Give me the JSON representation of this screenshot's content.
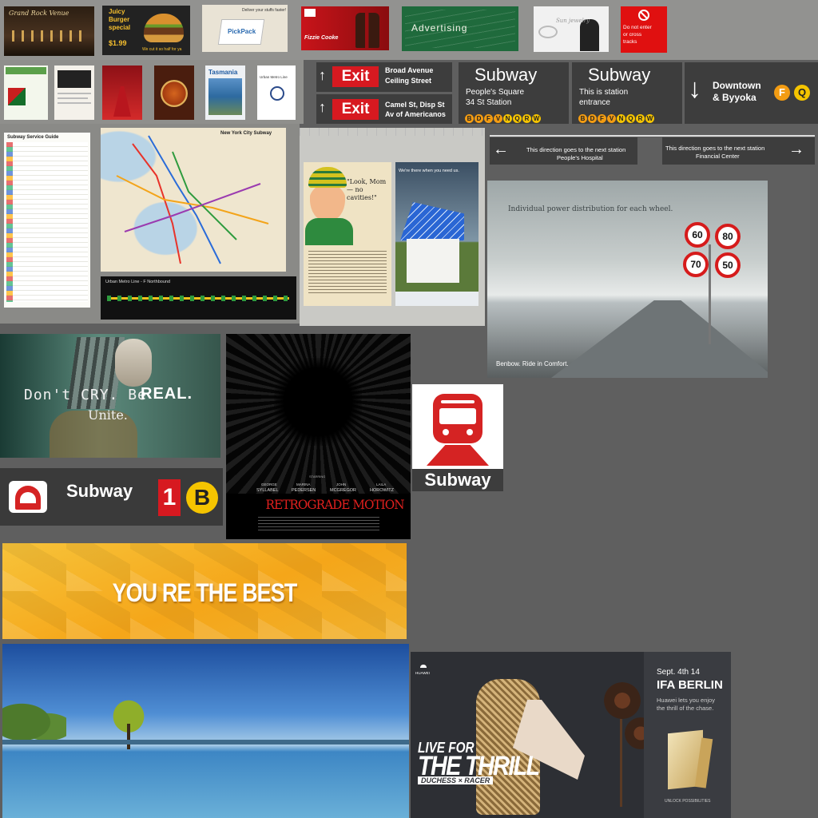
{
  "top_ads": {
    "restaurant": {
      "title": "Grand Rock Venue"
    },
    "burger": {
      "line1": "Juicy",
      "line2": "Burger",
      "line3": "special",
      "price": "$1.99",
      "tagline": "We cut it so half for ya"
    },
    "pickpack": {
      "header": "Deliver your stuffs faster!",
      "brand": "PickPack"
    },
    "cola": {
      "brand": "Fizzie Cooke"
    },
    "chalkboard": {
      "word": "Advertising"
    },
    "jewelry": {
      "brand": "Sun jewelry"
    },
    "no_entry": {
      "text": "Do not enter or cross tracks",
      "color": "#e01010"
    }
  },
  "leaflets": {
    "blue_card": {
      "title": "Tasmania"
    },
    "white_card": {
      "title": "Urban Metro Line"
    }
  },
  "exit_signs": [
    {
      "label": "Exit",
      "street1": "Broad Avenue",
      "street2": "Ceiling Street"
    },
    {
      "label": "Exit",
      "street1": "Camel St, Disp St",
      "street2": "Av of Americanos"
    }
  ],
  "station_signs": [
    {
      "title": "Subway",
      "sub1": "People's Square",
      "sub2": "34 St Station",
      "lines": [
        "B",
        "D",
        "F",
        "V",
        "N",
        "Q",
        "R",
        "W"
      ]
    },
    {
      "title": "Subway",
      "sub1": "This is station",
      "sub2": "entrance",
      "lines": [
        "B",
        "D",
        "F",
        "V",
        "N",
        "Q",
        "R",
        "W"
      ]
    }
  ],
  "downtown_sign": {
    "line1": "Downtown",
    "line2": "& Byyoka",
    "lines": [
      "F",
      "Q"
    ]
  },
  "direction_signs": [
    {
      "text1": "This direction goes to the next station",
      "text2": "People's Hospital"
    },
    {
      "text1": "This direction goes to the next station",
      "text2": "Financial Center"
    }
  ],
  "maps": {
    "service_guide": {
      "title": "Subway Service Guide"
    },
    "nyc_map": {
      "title": "New York City Subway"
    },
    "metro_strip": {
      "title": "Urban Metro Line - F Northbound"
    }
  },
  "vintage_ad": {
    "quote": "\"Look, Mom— no cavities!\"",
    "house_caption": "We're there when you need us."
  },
  "wheel_ad": {
    "headline": "Individual power distribution for each wheel.",
    "tagline": "Benbow. Ride in Comfort.",
    "speeds": [
      "60",
      "80",
      "70",
      "50"
    ]
  },
  "robot_ad": {
    "text1": "Don't CRY. Be",
    "text2": "REAL.",
    "text3": "Unite."
  },
  "movie_poster": {
    "starring": "STARRING",
    "actors": [
      {
        "first": "GEORGE",
        "last": "SYLLABEL"
      },
      {
        "first": "MARINA",
        "last": "PEDERSEN"
      },
      {
        "first": "JOHN",
        "last": "MCGREGOR"
      },
      {
        "first": "LAILA",
        "last": "HOROWITZ"
      }
    ],
    "title": "RETROGRADE MOTION"
  },
  "subway_logo_sign": {
    "label": "Subway"
  },
  "subway_sign_bottom": {
    "label": "Subway",
    "line_number": "1",
    "line_letter": "B"
  },
  "yellow_banner": {
    "text": "YOU RE THE BEST"
  },
  "huawei_ad": {
    "brand": "HUAWEI",
    "headline1": "LIVE FOR",
    "headline2": "THE THRILL",
    "subline": "DUCHESS × RACER",
    "date": "Sept. 4th 14",
    "event": "IFA BERLIN",
    "copy": "Huawei lets you enjoy the thrill of the chase.",
    "footer": "UNLOCK POSSIBILITIES"
  },
  "colors": {
    "background": "#5f5f5f",
    "sign_dark": "#3d3d3d",
    "exit_red": "#d71920",
    "badge_orange": "#f39c12",
    "badge_yellow": "#f5c400",
    "banner_yellow": "#f5b325"
  }
}
